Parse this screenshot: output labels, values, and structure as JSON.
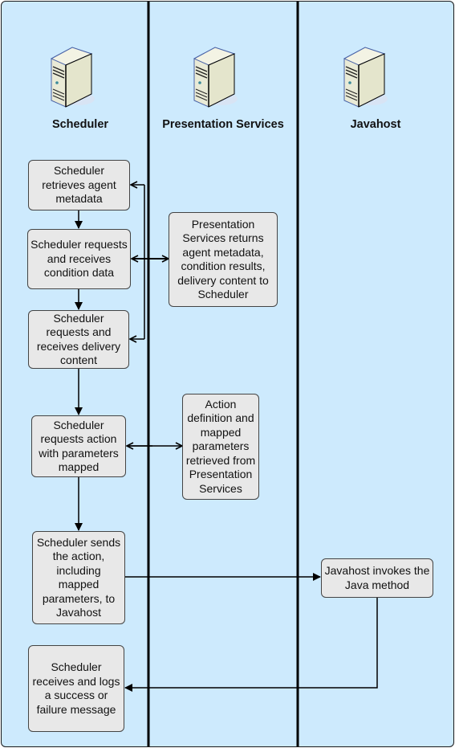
{
  "lanes": [
    {
      "title": "Scheduler",
      "icon": "server-icon"
    },
    {
      "title": "Presentation Services",
      "icon": "server-icon"
    },
    {
      "title": "Javahost",
      "icon": "server-icon"
    }
  ],
  "steps": {
    "s1": "Scheduler retrieves agent metadata",
    "s2": "Scheduler requests and receives condition data",
    "s3": "Scheduler requests and receives delivery content",
    "s4": "Scheduler requests action with parameters mapped",
    "s5": "Scheduler sends the action, including mapped parameters, to Javahost",
    "s6": "Scheduler receives and logs a success or failure message",
    "p1": "Presentation Services returns agent metadata, condition results, delivery content to Scheduler",
    "p2": "Action definition and mapped parameters retrieved from Presentation Services",
    "j1": "Javahost invokes the Java method"
  },
  "colors": {
    "background": "#cdeafd",
    "box": "#e8e8e8",
    "line": "#000000"
  }
}
